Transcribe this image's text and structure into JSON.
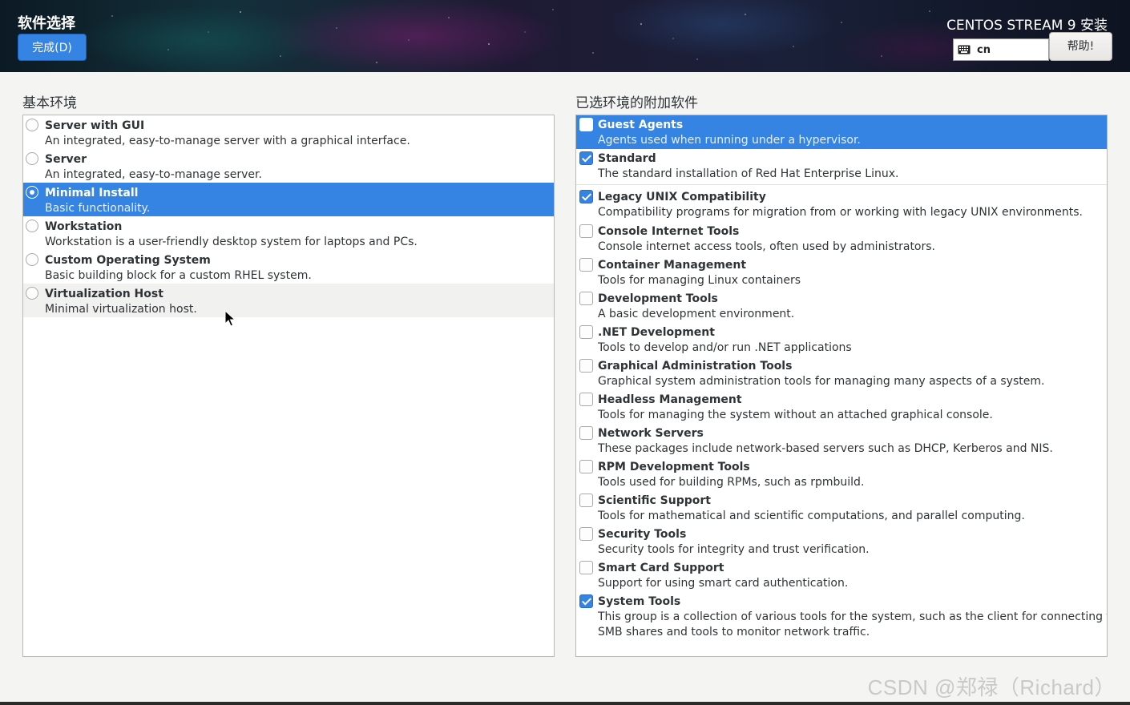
{
  "header": {
    "page_title": "软件选择",
    "done_label": "完成(D)",
    "product_title": "CENTOS STREAM 9 安装",
    "keyboard_layout": "cn",
    "help_label": "帮助!"
  },
  "base_environment": {
    "title": "基本环境",
    "selected_index": 2,
    "items": [
      {
        "title": "Server with GUI",
        "desc": "An integrated, easy-to-manage server with a graphical interface."
      },
      {
        "title": "Server",
        "desc": "An integrated, easy-to-manage server."
      },
      {
        "title": "Minimal Install",
        "desc": "Basic functionality."
      },
      {
        "title": "Workstation",
        "desc": "Workstation is a user-friendly desktop system for laptops and PCs."
      },
      {
        "title": "Custom Operating System",
        "desc": "Basic building block for a custom RHEL system."
      },
      {
        "title": "Virtualization Host",
        "desc": "Minimal virtualization host."
      }
    ]
  },
  "addons": {
    "title": "已选环境的附加软件",
    "items": [
      {
        "title": "Guest Agents",
        "desc": "Agents used when running under a hypervisor.",
        "checked": false,
        "selected": true
      },
      {
        "title": "Standard",
        "desc": "The standard installation of Red Hat Enterprise Linux.",
        "checked": true,
        "selected": false
      },
      {
        "title": "Legacy UNIX Compatibility",
        "desc": "Compatibility programs for migration from or working with legacy UNIX environments.",
        "checked": true,
        "selected": false
      },
      {
        "title": "Console Internet Tools",
        "desc": "Console internet access tools, often used by administrators.",
        "checked": false,
        "selected": false
      },
      {
        "title": "Container Management",
        "desc": "Tools for managing Linux containers",
        "checked": false,
        "selected": false
      },
      {
        "title": "Development Tools",
        "desc": "A basic development environment.",
        "checked": false,
        "selected": false
      },
      {
        "title": ".NET Development",
        "desc": "Tools to develop and/or run .NET applications",
        "checked": false,
        "selected": false
      },
      {
        "title": "Graphical Administration Tools",
        "desc": "Graphical system administration tools for managing many aspects of a system.",
        "checked": false,
        "selected": false
      },
      {
        "title": "Headless Management",
        "desc": "Tools for managing the system without an attached graphical console.",
        "checked": false,
        "selected": false
      },
      {
        "title": "Network Servers",
        "desc": "These packages include network-based servers such as DHCP, Kerberos and NIS.",
        "checked": false,
        "selected": false
      },
      {
        "title": "RPM Development Tools",
        "desc": "Tools used for building RPMs, such as rpmbuild.",
        "checked": false,
        "selected": false
      },
      {
        "title": "Scientific Support",
        "desc": "Tools for mathematical and scientific computations, and parallel computing.",
        "checked": false,
        "selected": false
      },
      {
        "title": "Security Tools",
        "desc": "Security tools for integrity and trust verification.",
        "checked": false,
        "selected": false
      },
      {
        "title": "Smart Card Support",
        "desc": "Support for using smart card authentication.",
        "checked": false,
        "selected": false
      },
      {
        "title": "System Tools",
        "desc": "This group is a collection of various tools for the system, such as the client for connecting to",
        "desc2": "SMB shares and tools to monitor network traffic.",
        "checked": true,
        "selected": false
      }
    ]
  },
  "watermark": "CSDN @郑禄（Richard）",
  "colors": {
    "accent": "#3584e4",
    "panel_border": "#b8b8b4",
    "background": "#f4f4f3"
  }
}
